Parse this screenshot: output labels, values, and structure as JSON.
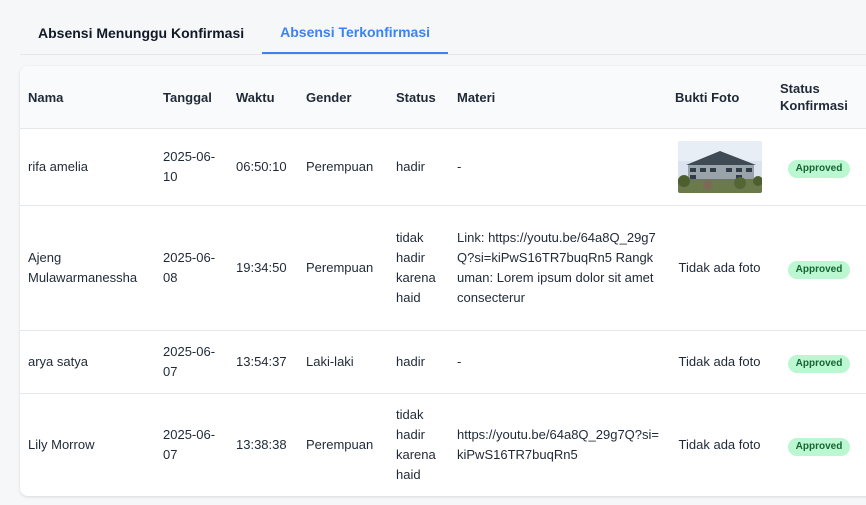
{
  "tabs": [
    {
      "label": "Absensi Menunggu Konfirmasi",
      "active": false
    },
    {
      "label": "Absensi Terkonfirmasi",
      "active": true
    }
  ],
  "table": {
    "headers": {
      "nama": "Nama",
      "tanggal": "Tanggal",
      "waktu": "Waktu",
      "gender": "Gender",
      "status": "Status",
      "materi": "Materi",
      "bukti_foto": "Bukti Foto",
      "status_konfirmasi": "Status Konfirmasi"
    },
    "rows": [
      {
        "nama": "rifa amelia",
        "tanggal": "2025-06-10",
        "waktu": "06:50:10",
        "gender": "Perempuan",
        "status": "hadir",
        "materi": "-",
        "bukti_foto": "",
        "status_konfirmasi": "Approved"
      },
      {
        "nama": "Ajeng Mulawarmanessha",
        "tanggal": "2025-06-08",
        "waktu": "19:34:50",
        "gender": "Perempuan",
        "status": "tidak hadir karena haid",
        "materi": "Link: https://youtu.be/64a8Q_29g7Q?si=kiPwS16TR7buqRn5 Rangkuman: Lorem ipsum dolor sit amet consecterur",
        "bukti_foto": "Tidak ada foto",
        "status_konfirmasi": "Approved"
      },
      {
        "nama": "arya satya",
        "tanggal": "2025-06-07",
        "waktu": "13:54:37",
        "gender": "Laki-laki",
        "status": "hadir",
        "materi": "-",
        "bukti_foto": "Tidak ada foto",
        "status_konfirmasi": "Approved"
      },
      {
        "nama": "Lily Morrow",
        "tanggal": "2025-06-07",
        "waktu": "13:38:38",
        "gender": "Perempuan",
        "status": "tidak hadir karena haid",
        "materi": "https://youtu.be/64a8Q_29g7Q?si=kiPwS16TR7buqRn5",
        "bukti_foto": "Tidak ada foto",
        "status_konfirmasi": "Approved"
      }
    ]
  },
  "colors": {
    "accent": "#3b82f6",
    "badge_bg": "#bbf7d0",
    "badge_text": "#166534"
  }
}
